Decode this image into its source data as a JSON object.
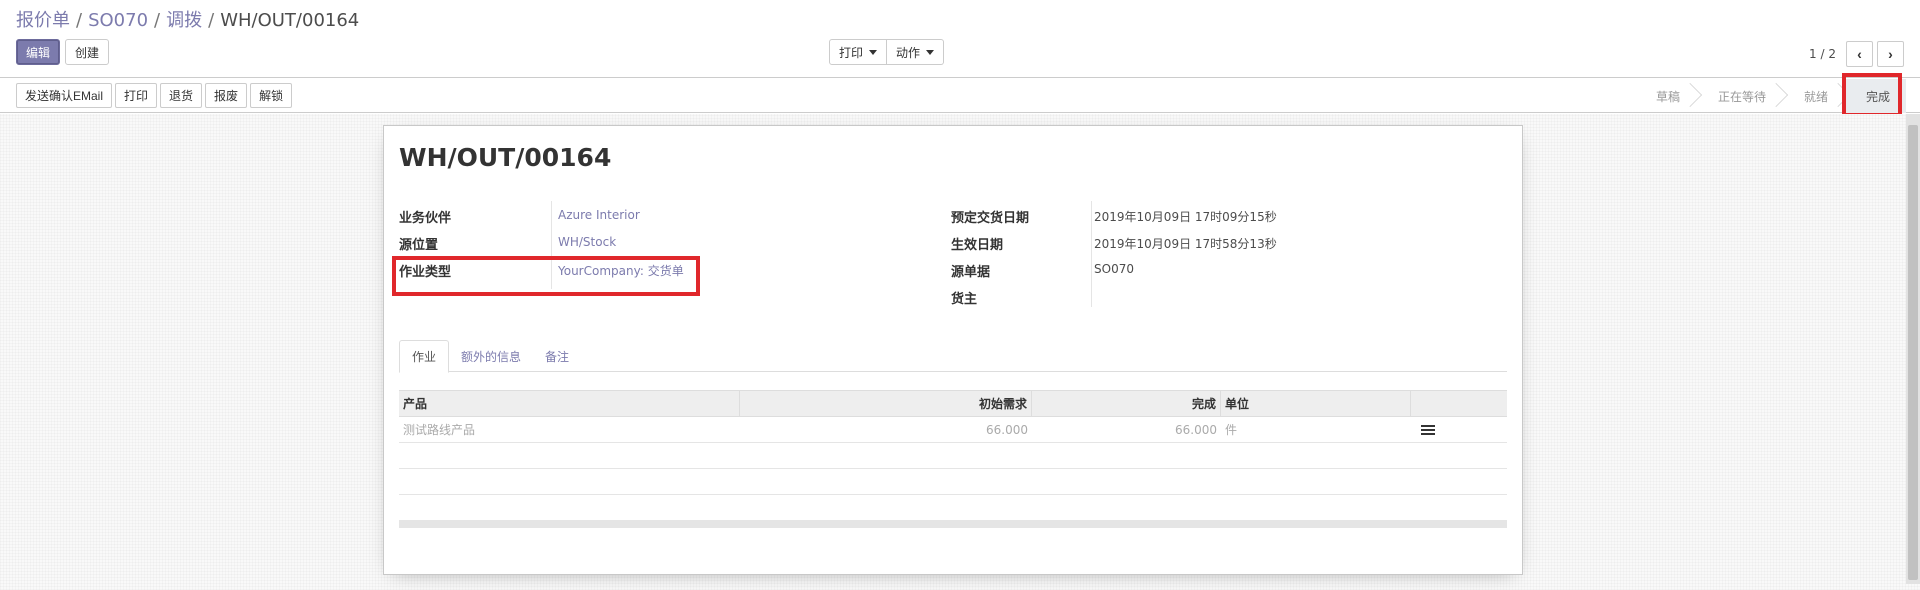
{
  "breadcrumb": {
    "items": [
      "报价单",
      "SO070",
      "调拨"
    ],
    "current": "WH/OUT/00164",
    "separator": "/"
  },
  "control_panel": {
    "edit_label": "编辑",
    "create_label": "创建",
    "print_label": "打印",
    "action_label": "动作",
    "pager_value": "1 / 2",
    "pager_prev": "‹",
    "pager_next": "›"
  },
  "header": {
    "buttons": [
      "发送确认EMail",
      "打印",
      "退货",
      "报废",
      "解锁"
    ],
    "statuses": [
      "草稿",
      "正在等待",
      "就绪",
      "完成"
    ],
    "active_status": "完成"
  },
  "record": {
    "title": "WH/OUT/00164",
    "left_fields": [
      {
        "label": "业务伙伴",
        "value": "Azure Interior"
      },
      {
        "label": "源位置",
        "value": "WH/Stock"
      },
      {
        "label": "作业类型",
        "value": "YourCompany: 交货单"
      }
    ],
    "right_fields": [
      {
        "label": "预定交货日期",
        "value": "2019年10月09日 17时09分15秒"
      },
      {
        "label": "生效日期",
        "value": "2019年10月09日 17时58分13秒"
      },
      {
        "label": "源单据",
        "value": "SO070"
      },
      {
        "label": "货主",
        "value": ""
      }
    ]
  },
  "tabs": [
    "作业",
    "额外的信息",
    "备注"
  ],
  "operations_table": {
    "columns": [
      "产品",
      "初始需求",
      "完成",
      "单位"
    ],
    "rows": [
      {
        "product": "测试路线产品",
        "demand": "66.000",
        "done": "66.000",
        "uom": "件"
      }
    ]
  },
  "colors": {
    "primary": "#7c7bad",
    "highlight": "#e0272b"
  },
  "icons": {
    "detail": "list-icon",
    "prev": "chevron-left-icon",
    "next": "chevron-right-icon"
  }
}
